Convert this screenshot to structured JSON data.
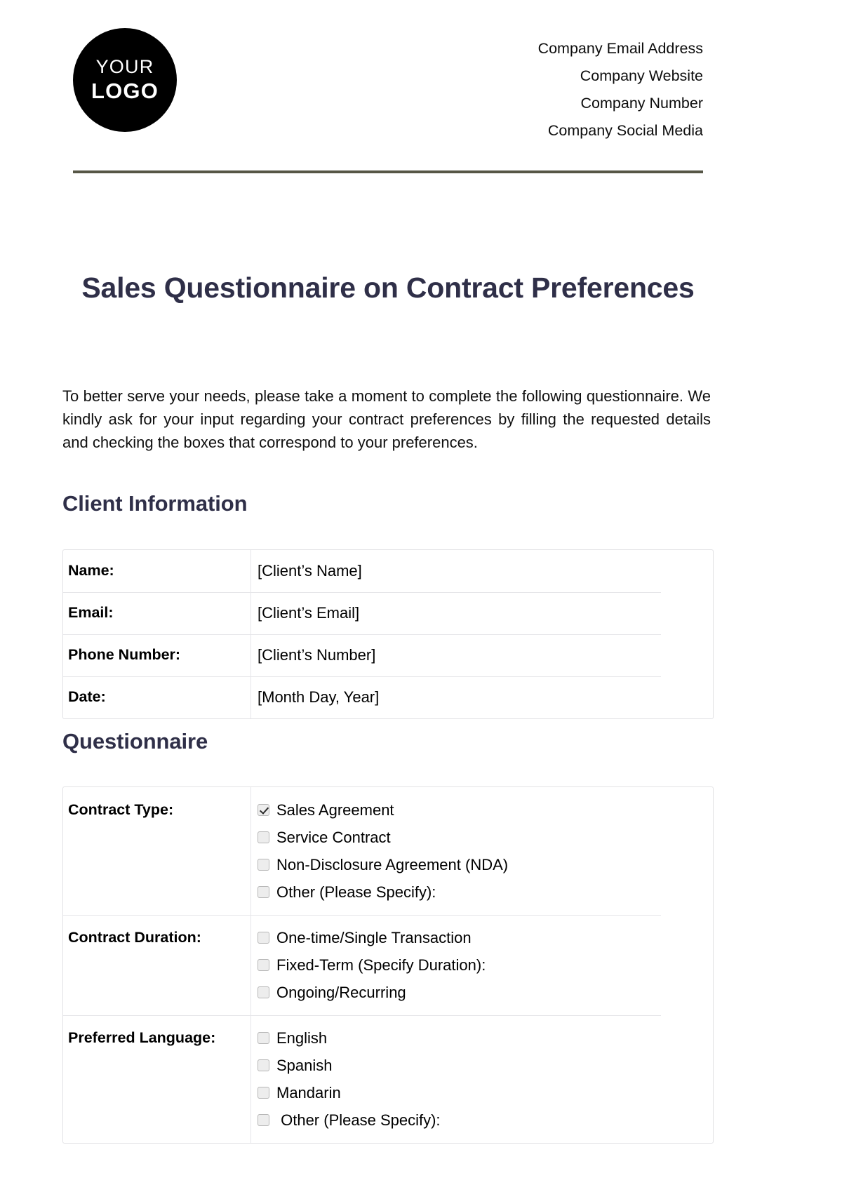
{
  "brand": {
    "logo_line1": "YOUR",
    "logo_line2": "LOGO",
    "rule_color": "#565646",
    "heading_color": "#2f2f48"
  },
  "header": {
    "contacts": [
      "Company Email Address",
      "Company Website",
      "Company Number",
      "Company Social Media"
    ]
  },
  "document": {
    "title": "Sales Questionnaire on Contract Preferences",
    "intro": "To better serve your needs,  please take a moment to complete the following questionnaire. We kindly ask for your input regarding your contract preferences by filling the requested details and checking the boxes that correspond to your preferences."
  },
  "client_information": {
    "heading": "Client Information",
    "rows": [
      {
        "label": "Name:",
        "value": "[Client’s Name]"
      },
      {
        "label": "Email:",
        "value": "[Client’s Email]"
      },
      {
        "label": "Phone Number:",
        "value": "[Client’s Number]"
      },
      {
        "label": "Date:",
        "value": "[Month Day, Year]"
      }
    ]
  },
  "questionnaire": {
    "heading": "Questionnaire",
    "rows": [
      {
        "label": "Contract Type:",
        "options": [
          {
            "text": "Sales Agreement",
            "checked": true
          },
          {
            "text": "Service Contract",
            "checked": false
          },
          {
            "text": "Non-Disclosure Agreement (NDA)",
            "checked": false
          },
          {
            "text": "Other (Please Specify):",
            "checked": false
          }
        ]
      },
      {
        "label": "Contract Duration:",
        "options": [
          {
            "text": "One-time/Single Transaction",
            "checked": false
          },
          {
            "text": "Fixed-Term (Specify Duration):",
            "checked": false
          },
          {
            "text": "Ongoing/Recurring",
            "checked": false
          }
        ]
      },
      {
        "label": "Preferred Language:",
        "options": [
          {
            "text": "English",
            "checked": false
          },
          {
            "text": "Spanish",
            "checked": false
          },
          {
            "text": "Mandarin",
            "checked": false
          },
          {
            "text": " Other (Please Specify):",
            "checked": false
          }
        ]
      }
    ]
  }
}
